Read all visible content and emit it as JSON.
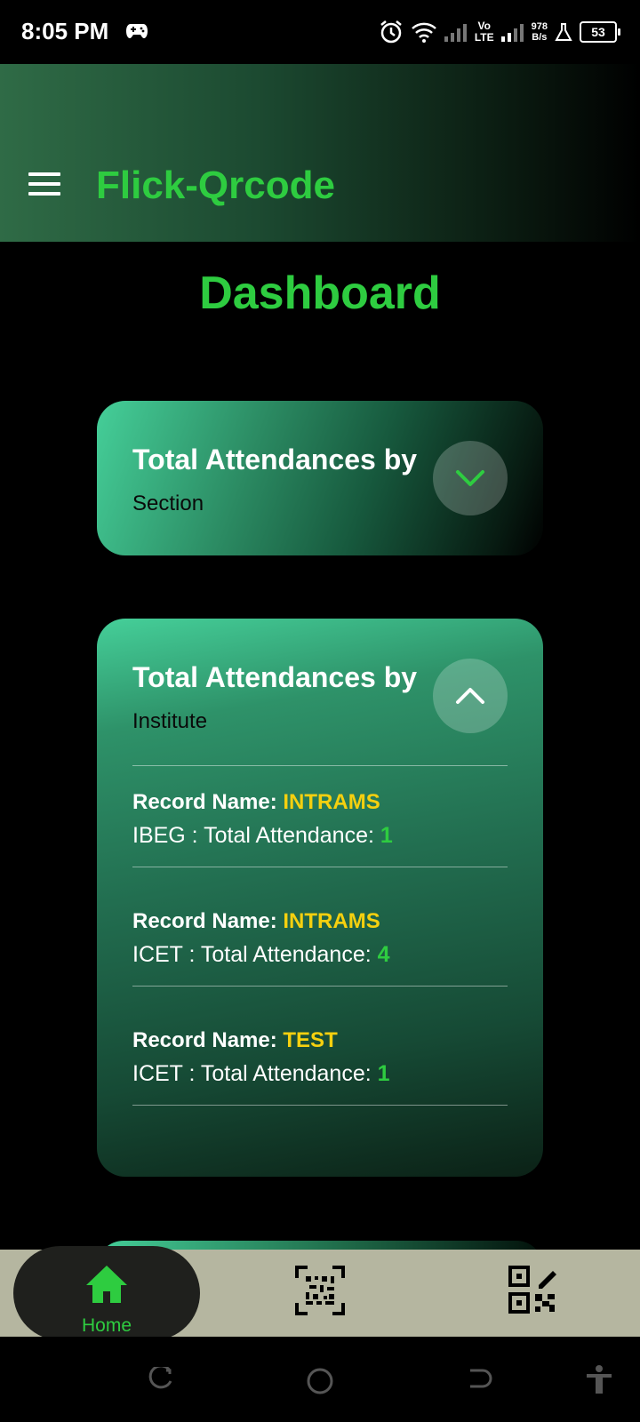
{
  "status_bar": {
    "time": "8:05 PM",
    "network_lte_top": "Vo",
    "network_lte_bottom": "LTE",
    "speed_value": "978",
    "speed_unit": "B/s",
    "battery": "53",
    "icons": [
      "gamepad-icon",
      "alarm-icon",
      "wifi-icon",
      "signal-icon",
      "flask-icon",
      "battery-icon"
    ]
  },
  "app_bar": {
    "title": "Flick-Qrcode",
    "menu_icon": "hamburger-menu-icon"
  },
  "page": {
    "title": "Dashboard"
  },
  "cards": {
    "section": {
      "heading": "Total Attendances by",
      "sub": "Section",
      "expanded": false
    },
    "institute": {
      "heading": "Total Attendances by",
      "sub": "Institute",
      "expanded": true,
      "records": [
        {
          "label": "Record Name:",
          "name": "INTRAMS",
          "prefix": "IBEG : Total Attendance:",
          "count": "1"
        },
        {
          "label": "Record Name:",
          "name": "INTRAMS",
          "prefix": "ICET : Total Attendance:",
          "count": "4"
        },
        {
          "label": "Record Name:",
          "name": "TEST",
          "prefix": "ICET : Total Attendance:",
          "count": "1"
        }
      ]
    }
  },
  "bottom_nav": {
    "home_label": "Home",
    "items": [
      "home-icon",
      "barcode-scan-icon",
      "qr-code-edit-icon"
    ]
  },
  "colors": {
    "accent_green": "#2ecc40",
    "record_yellow": "#f5d00f",
    "nav_bg": "#b5b6a0"
  }
}
